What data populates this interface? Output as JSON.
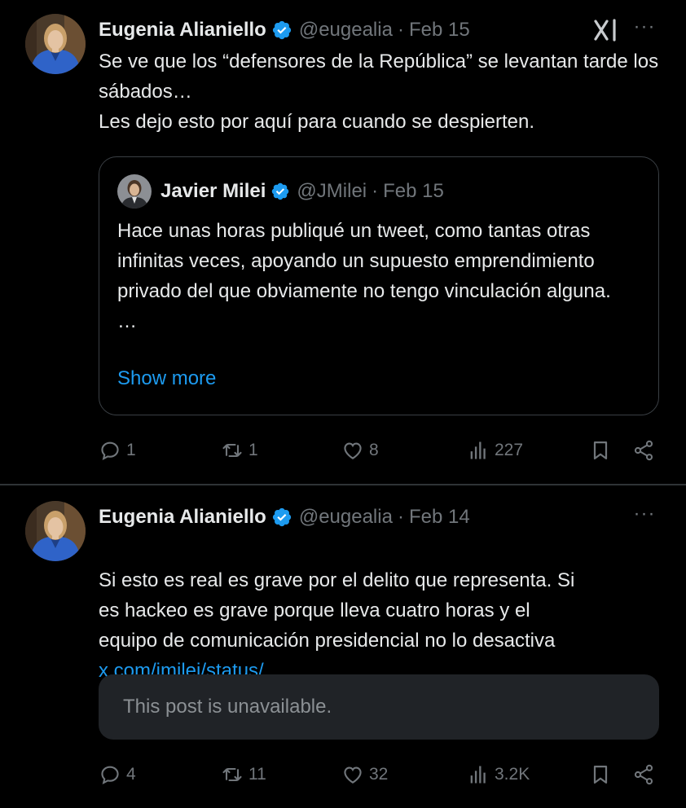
{
  "tweets": [
    {
      "author_name": "Eugenia Alianiello",
      "handle": "@eugealia",
      "date": "Feb 15",
      "text": "Se ve que los “defensores de la República” se levantan tarde los sábados…\nLes dejo esto por aquí para cuando se despierten.",
      "quote": {
        "author_name": "Javier Milei",
        "handle": "@JMilei",
        "date": "Feb 15",
        "text": "Hace unas horas publiqué un tweet, como tantas otras infinitas veces, apoyando un supuesto emprendimiento privado del que obviamente no tengo vinculación alguna.\n…",
        "show_more": "Show more"
      },
      "stats": {
        "replies": "1",
        "retweets": "1",
        "likes": "8",
        "views": "227"
      }
    },
    {
      "author_name": "Eugenia Alianiello",
      "handle": "@eugealia",
      "date": "Feb 14",
      "text": "Si esto es real es grave por el delito que representa. Si\nes hackeo es grave porque lleva cuatro horas y el\nequipo de comunicación presidencial no lo desactiva",
      "link": "x.com/jmilei/status/…",
      "unavailable_text": "This post is unavailable.",
      "stats": {
        "replies": "4",
        "retweets": "11",
        "likes": "32",
        "views": "3.2K"
      }
    }
  ],
  "separator": "·",
  "more_glyph": "···",
  "colors": {
    "background": "#000000",
    "text": "#e7e9ea",
    "muted": "#71767b",
    "link": "#1d9bf0",
    "verified": "#1d9bf0"
  }
}
